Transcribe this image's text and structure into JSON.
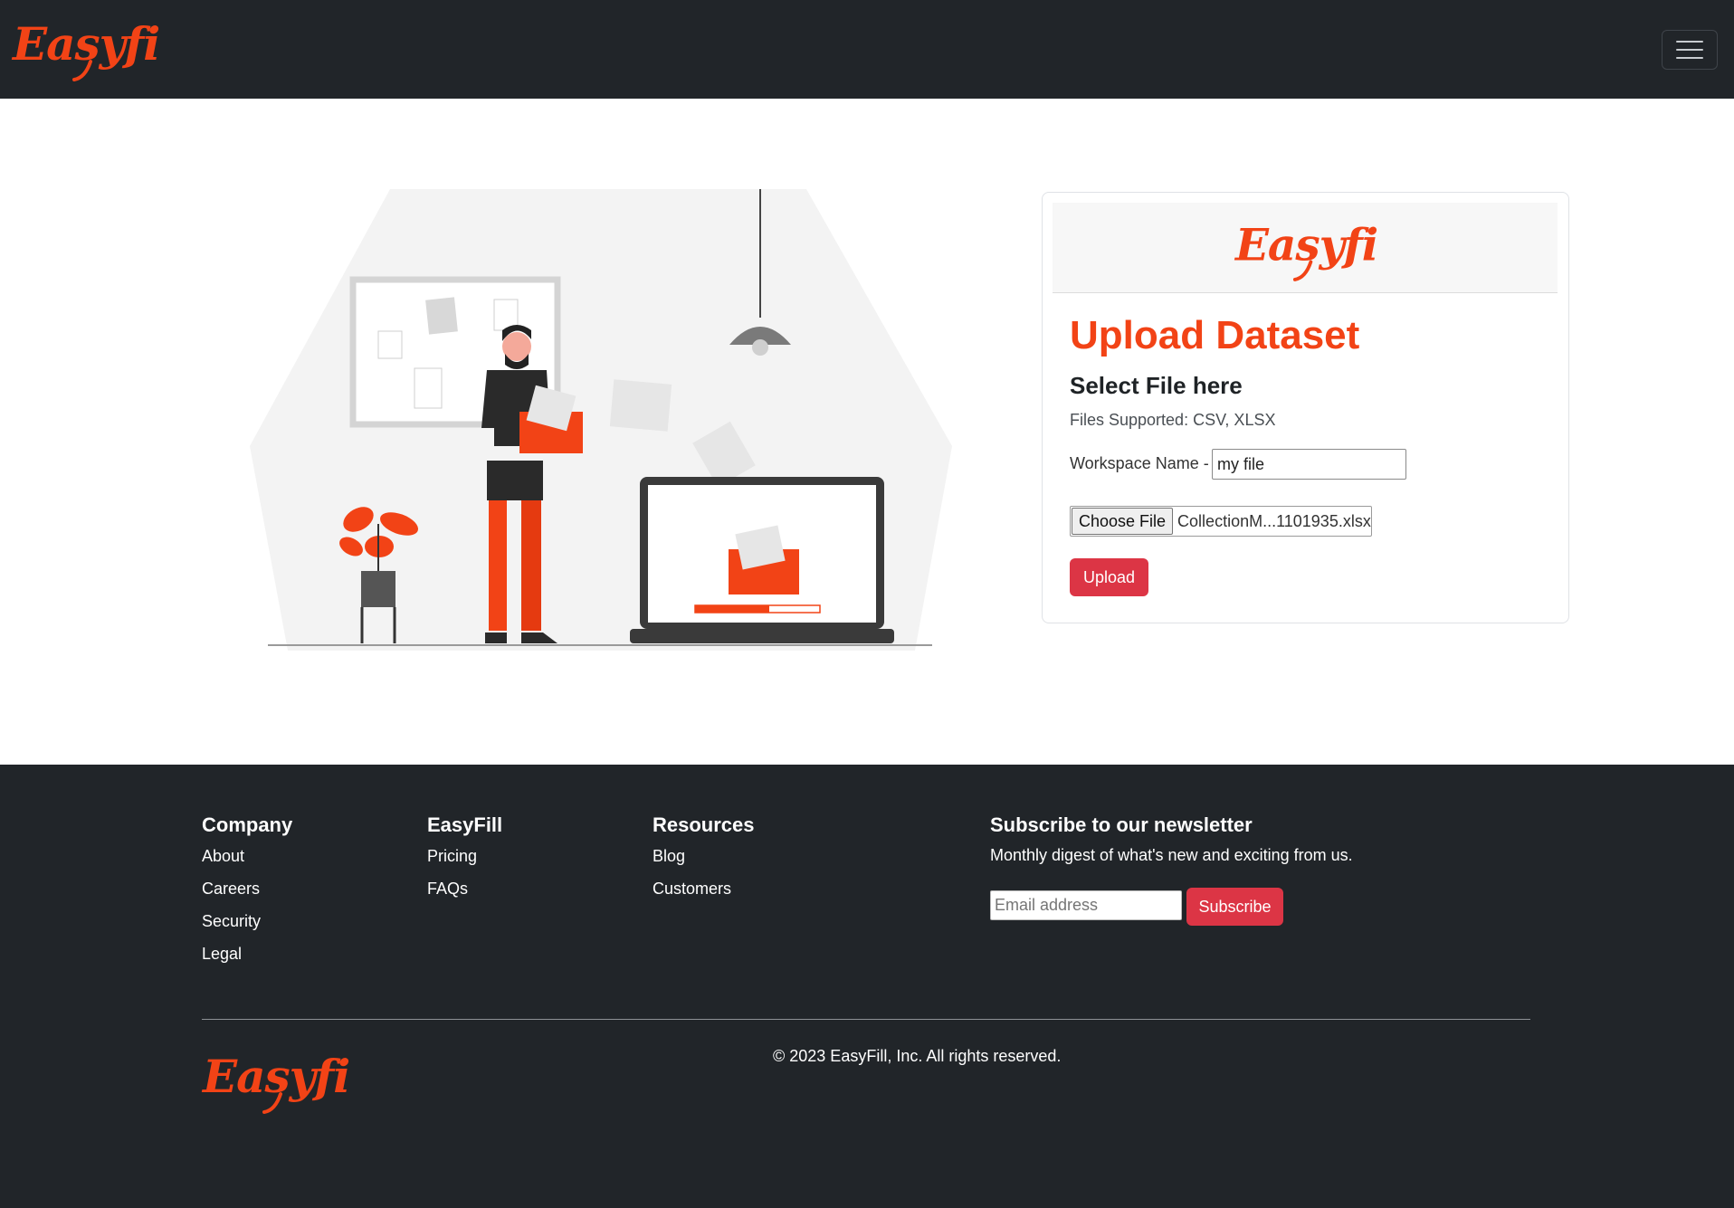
{
  "brand": {
    "name": "Easyfill",
    "accent_color": "#f24316"
  },
  "navbar": {
    "toggler_icon": "hamburger-icon"
  },
  "upload_card": {
    "title": "Upload Dataset",
    "subtitle": "Select File here",
    "supported": "Files Supported: CSV, XLSX",
    "workspace_label": "Workspace Name -",
    "workspace_value": "my file",
    "choose_file_label": "Choose File",
    "file_name": "CollectionM...1101935.xlsx",
    "upload_label": "Upload",
    "button_color": "#dc3545"
  },
  "footer": {
    "columns": [
      {
        "heading": "Company",
        "links": [
          "About",
          "Careers",
          "Security",
          "Legal"
        ]
      },
      {
        "heading": "EasyFill",
        "links": [
          "Pricing",
          "FAQs"
        ]
      },
      {
        "heading": "Resources",
        "links": [
          "Blog",
          "Customers"
        ]
      }
    ],
    "newsletter": {
      "heading": "Subscribe to our newsletter",
      "text": "Monthly digest of what's new and exciting from us.",
      "placeholder": "Email address",
      "button": "Subscribe"
    },
    "copyright": "© 2023 EasyFill, Inc. All rights reserved."
  }
}
